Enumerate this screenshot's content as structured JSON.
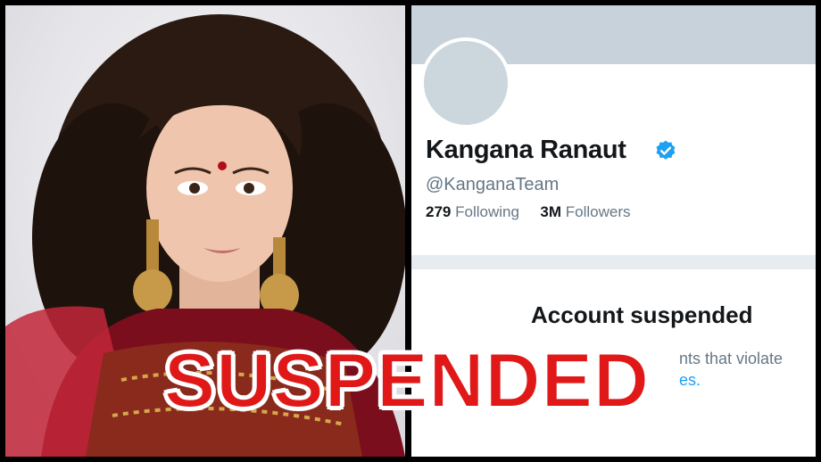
{
  "profile": {
    "display_name": "Kangana Ranaut",
    "handle": "@KanganaTeam",
    "following_count": "279",
    "following_label": "Following",
    "followers_count": "3M",
    "followers_label": "Followers"
  },
  "notice": {
    "title": "Account suspended",
    "body_fragment": "nts that violate",
    "link_fragment": "es."
  },
  "overlay": {
    "label": "SUSPENDED"
  },
  "colors": {
    "overlay_red": "#e01818",
    "verified_blue": "#1da1f2",
    "banner": "#c8d2da"
  },
  "icons": {
    "verified": "verified-badge-icon"
  }
}
